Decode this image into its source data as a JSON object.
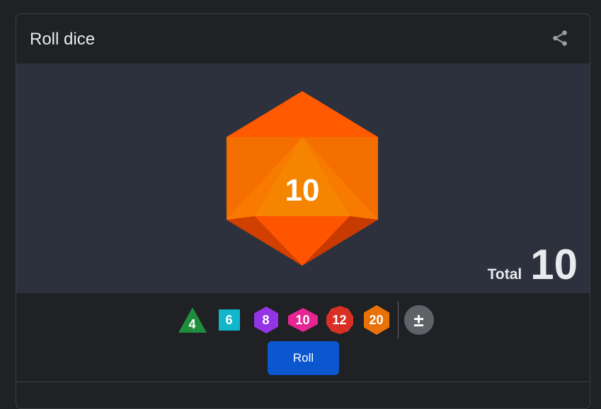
{
  "header": {
    "title": "Roll dice",
    "share_icon": "share-icon"
  },
  "result": {
    "die_value": "10",
    "total_label": "Total",
    "total_value": "10"
  },
  "dice_types": [
    {
      "id": "d4",
      "label": "4",
      "color": "#1e8e3e"
    },
    {
      "id": "d6",
      "label": "6",
      "color": "#12b5cb"
    },
    {
      "id": "d8",
      "label": "8",
      "color": "#9334e6"
    },
    {
      "id": "d10",
      "label": "10",
      "color": "#e52592"
    },
    {
      "id": "d12",
      "label": "12",
      "color": "#d93025"
    },
    {
      "id": "d20",
      "label": "20",
      "color": "#e8710a"
    }
  ],
  "modifier": {
    "label": "±",
    "icon": "plus-minus-icon"
  },
  "roll_button": {
    "label": "Roll"
  },
  "colors": {
    "background": "#202124",
    "stage": "#2d313d",
    "accent": "#0b57d0",
    "big_die": "#ff6d00"
  }
}
